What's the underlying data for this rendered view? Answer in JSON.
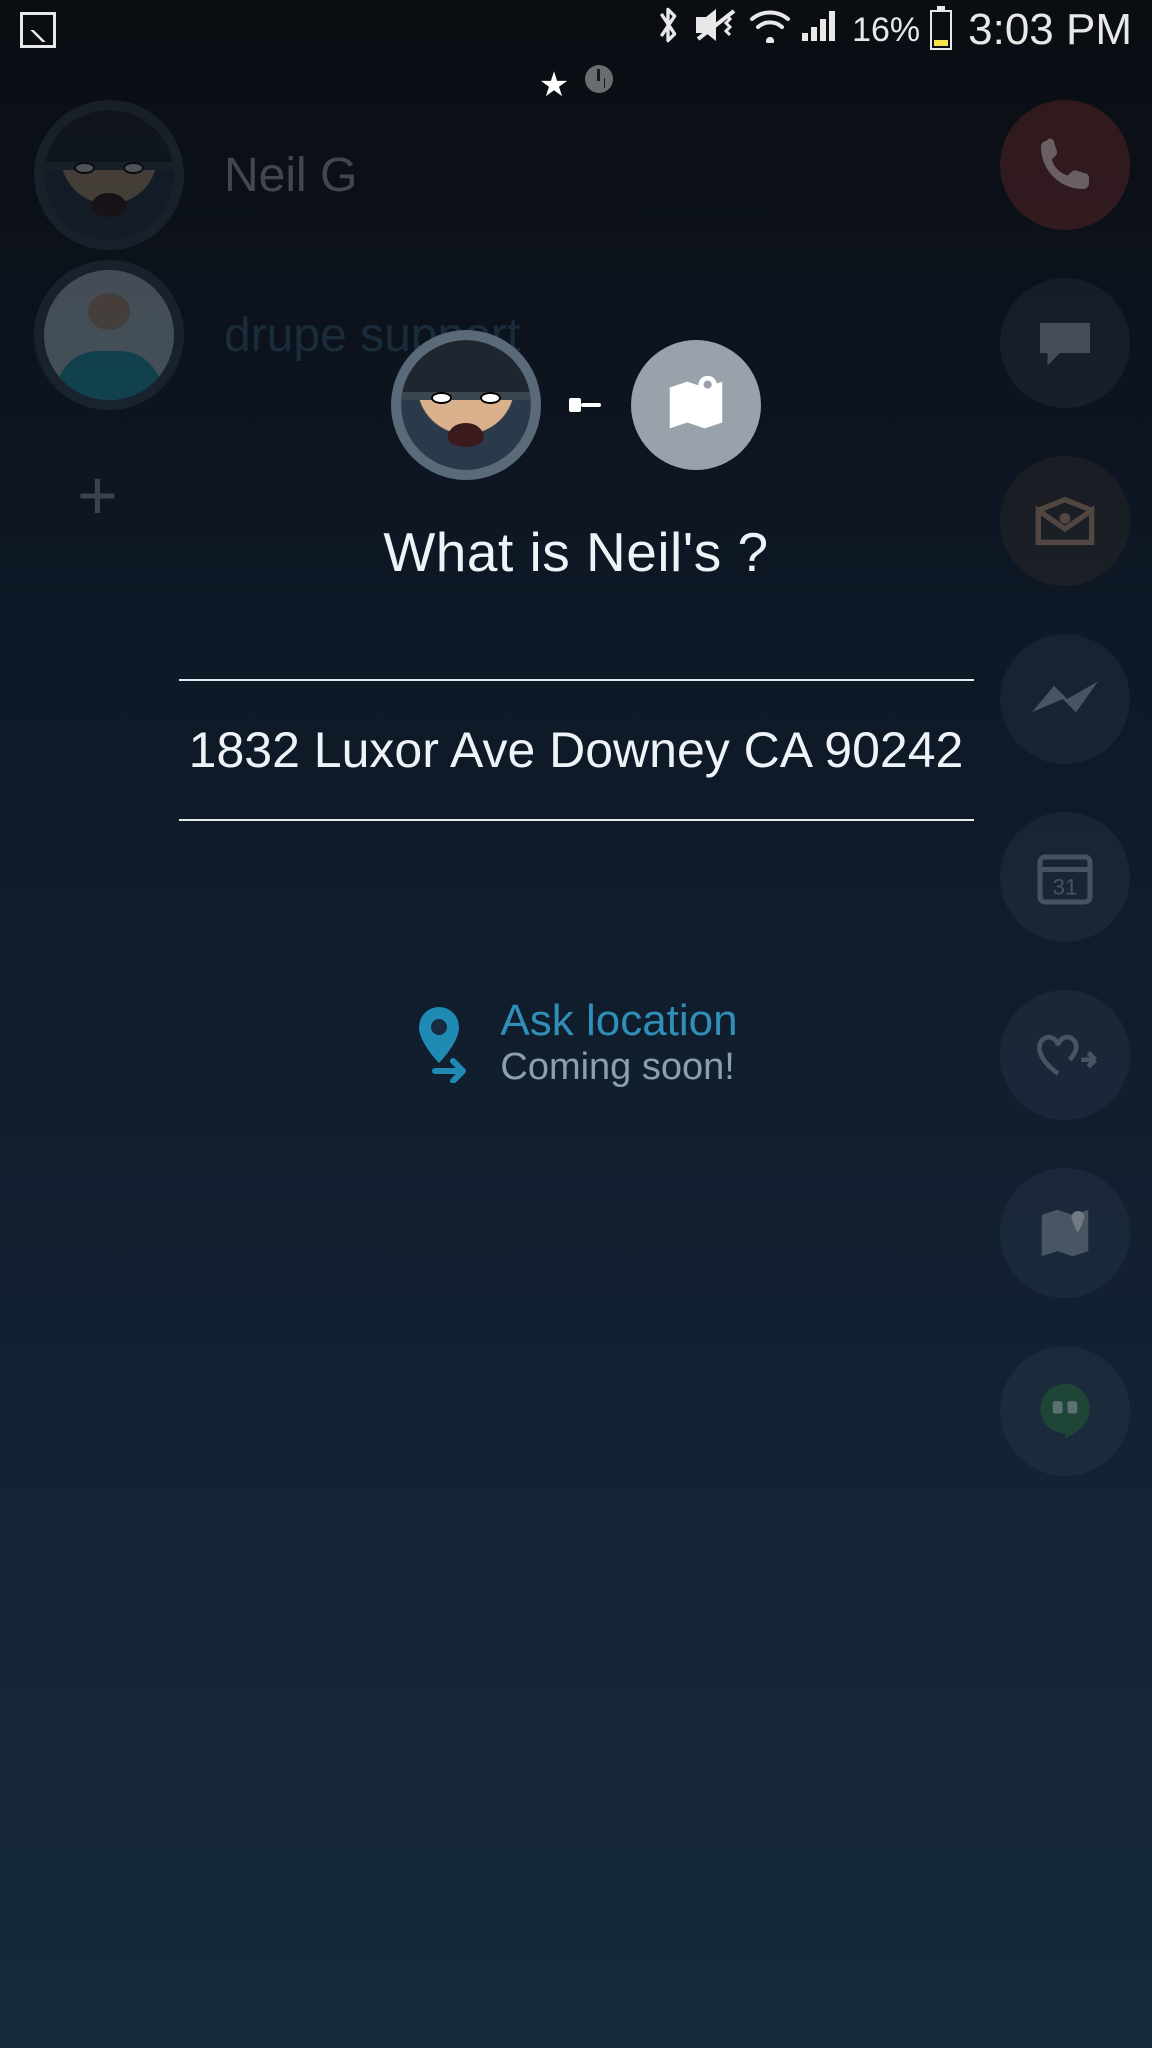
{
  "status": {
    "battery_pct": "16%",
    "time": "3:03 PM"
  },
  "tabs": {
    "favorites_icon": "star-icon",
    "recent_icon": "clock-icon"
  },
  "bg_contacts": [
    {
      "name": "Neil G"
    },
    {
      "name": "drupe support"
    }
  ],
  "actions": {
    "call": "phone-icon",
    "sms": "message-icon",
    "email": "email-icon",
    "messenger": "messenger-icon",
    "calendar": "calendar-icon",
    "favorite_send": "heart-share-icon",
    "navigate": "map-icon",
    "hangouts": "hangouts-icon"
  },
  "modal": {
    "question": "What is Neil's ?",
    "address": "1832 Luxor Ave Downey CA 90242",
    "ask_location": {
      "title": "Ask location",
      "subtitle": "Coming soon!"
    }
  }
}
